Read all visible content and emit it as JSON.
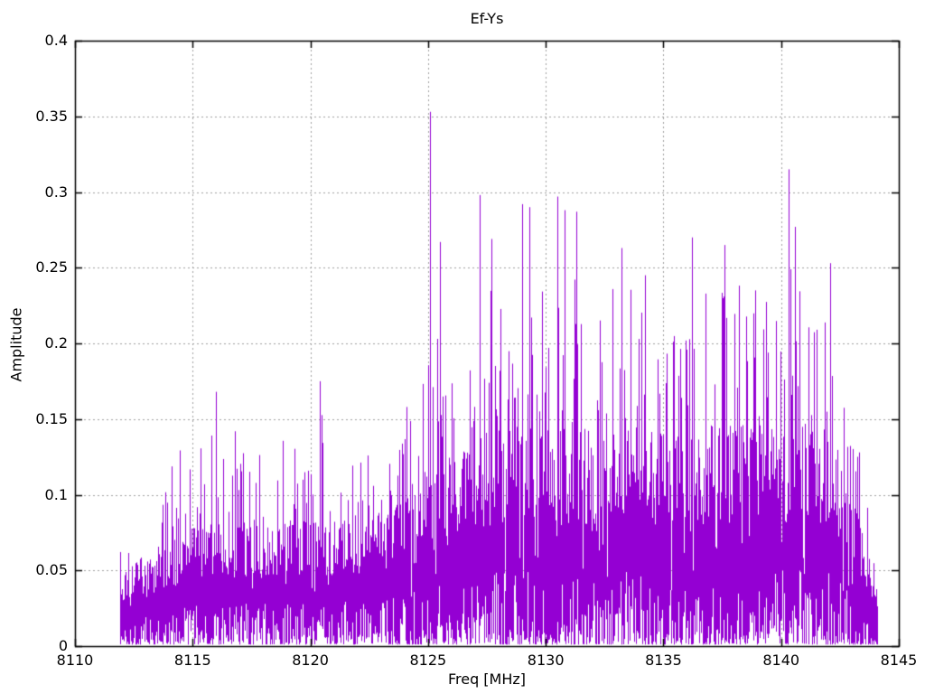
{
  "window": {
    "title": "Ef-Ys"
  },
  "chart_data": {
    "type": "line",
    "title": "Ef-Ys",
    "xlabel": "Freq [MHz]",
    "ylabel": "Amplitude",
    "xlim": [
      8110,
      8145
    ],
    "ylim": [
      0,
      0.4
    ],
    "x_ticks": [
      8110,
      8115,
      8120,
      8125,
      8130,
      8135,
      8140,
      8145
    ],
    "x_tick_labels": [
      "8110",
      "8115",
      "8120",
      "8125",
      "8130",
      "8135",
      "8140",
      "8145"
    ],
    "y_ticks": [
      0,
      0.05,
      0.1,
      0.15,
      0.2,
      0.25,
      0.3,
      0.35,
      0.4
    ],
    "y_tick_labels": [
      "0",
      "0.05",
      "0.1",
      "0.15",
      "0.2",
      "0.25",
      "0.3",
      "0.35",
      "0.4"
    ],
    "grid": true,
    "grid_style": "dotted",
    "legend_position": "none",
    "series": [
      {
        "name": "Ef-Ys",
        "color": "#9400d3",
        "description": "dense noisy amplitude spectrum, signal present from 8111.9 to 8144.1 MHz",
        "data_range_mhz": [
          8111.9,
          8144.1
        ],
        "noise_floor": 0.005,
        "peak_envelope": [
          [
            8112.0,
            0.068
          ],
          [
            8112.5,
            0.075
          ],
          [
            8113.0,
            0.092
          ],
          [
            8113.5,
            0.105
          ],
          [
            8114.0,
            0.125
          ],
          [
            8114.5,
            0.15
          ],
          [
            8115.0,
            0.135
          ],
          [
            8115.5,
            0.155
          ],
          [
            8116.0,
            0.165
          ],
          [
            8116.5,
            0.145
          ],
          [
            8117.0,
            0.155
          ],
          [
            8117.5,
            0.135
          ],
          [
            8118.0,
            0.125
          ],
          [
            8118.5,
            0.155
          ],
          [
            8119.0,
            0.135
          ],
          [
            8119.5,
            0.145
          ],
          [
            8120.0,
            0.14
          ],
          [
            8120.5,
            0.17
          ],
          [
            8121.0,
            0.135
          ],
          [
            8121.5,
            0.14
          ],
          [
            8122.0,
            0.125
          ],
          [
            8122.5,
            0.13
          ],
          [
            8123.0,
            0.145
          ],
          [
            8123.5,
            0.135
          ],
          [
            8124.0,
            0.15
          ],
          [
            8124.5,
            0.155
          ],
          [
            8125.0,
            0.19
          ],
          [
            8125.5,
            0.22
          ],
          [
            8126.0,
            0.2
          ],
          [
            8126.5,
            0.215
          ],
          [
            8127.0,
            0.23
          ],
          [
            8127.5,
            0.25
          ],
          [
            8128.0,
            0.235
          ],
          [
            8128.5,
            0.23
          ],
          [
            8129.0,
            0.25
          ],
          [
            8129.5,
            0.235
          ],
          [
            8130.0,
            0.26
          ],
          [
            8130.5,
            0.27
          ],
          [
            8131.0,
            0.245
          ],
          [
            8131.5,
            0.26
          ],
          [
            8132.0,
            0.225
          ],
          [
            8132.5,
            0.235
          ],
          [
            8133.0,
            0.24
          ],
          [
            8133.5,
            0.26
          ],
          [
            8134.0,
            0.25
          ],
          [
            8134.5,
            0.255
          ],
          [
            8135.0,
            0.245
          ],
          [
            8135.5,
            0.225
          ],
          [
            8136.0,
            0.24
          ],
          [
            8136.5,
            0.26
          ],
          [
            8137.0,
            0.225
          ],
          [
            8137.5,
            0.24
          ],
          [
            8138.0,
            0.255
          ],
          [
            8138.5,
            0.235
          ],
          [
            8139.0,
            0.24
          ],
          [
            8139.5,
            0.23
          ],
          [
            8140.0,
            0.23
          ],
          [
            8140.5,
            0.26
          ],
          [
            8141.0,
            0.235
          ],
          [
            8141.5,
            0.24
          ],
          [
            8142.0,
            0.245
          ],
          [
            8142.5,
            0.21
          ],
          [
            8143.0,
            0.175
          ],
          [
            8143.5,
            0.125
          ],
          [
            8144.0,
            0.06
          ]
        ],
        "dense_body_top": [
          [
            8112,
            0.045
          ],
          [
            8113,
            0.055
          ],
          [
            8114,
            0.065
          ],
          [
            8115,
            0.075
          ],
          [
            8116,
            0.08
          ],
          [
            8117,
            0.08
          ],
          [
            8118,
            0.075
          ],
          [
            8119,
            0.08
          ],
          [
            8120,
            0.08
          ],
          [
            8121,
            0.08
          ],
          [
            8122,
            0.08
          ],
          [
            8123,
            0.085
          ],
          [
            8124,
            0.095
          ],
          [
            8125,
            0.105
          ],
          [
            8126,
            0.115
          ],
          [
            8127,
            0.13
          ],
          [
            8128,
            0.14
          ],
          [
            8129,
            0.14
          ],
          [
            8130,
            0.145
          ],
          [
            8131,
            0.14
          ],
          [
            8132,
            0.13
          ],
          [
            8133,
            0.135
          ],
          [
            8134,
            0.14
          ],
          [
            8135,
            0.135
          ],
          [
            8136,
            0.13
          ],
          [
            8137,
            0.135
          ],
          [
            8138,
            0.14
          ],
          [
            8139,
            0.14
          ],
          [
            8140,
            0.14
          ],
          [
            8141,
            0.145
          ],
          [
            8142,
            0.135
          ],
          [
            8143,
            0.1
          ],
          [
            8144,
            0.04
          ]
        ],
        "notable_peaks": [
          [
            8125.1,
            0.353
          ],
          [
            8125.5,
            0.267
          ],
          [
            8127.2,
            0.298
          ],
          [
            8127.7,
            0.269
          ],
          [
            8129.0,
            0.292
          ],
          [
            8129.3,
            0.29
          ],
          [
            8130.5,
            0.297
          ],
          [
            8130.8,
            0.288
          ],
          [
            8131.3,
            0.287
          ],
          [
            8133.2,
            0.263
          ],
          [
            8134.2,
            0.245
          ],
          [
            8136.2,
            0.27
          ],
          [
            8137.6,
            0.265
          ],
          [
            8138.9,
            0.235
          ],
          [
            8140.3,
            0.315
          ],
          [
            8140.6,
            0.277
          ],
          [
            8142.1,
            0.253
          ],
          [
            8120.4,
            0.175
          ],
          [
            8116.0,
            0.168
          ],
          [
            8124.1,
            0.158
          ]
        ]
      }
    ],
    "colors": {
      "trace": "#9400d3",
      "grid": "#a0a0a0",
      "border": "#000000",
      "background": "#ffffff",
      "text": "#000000"
    }
  }
}
